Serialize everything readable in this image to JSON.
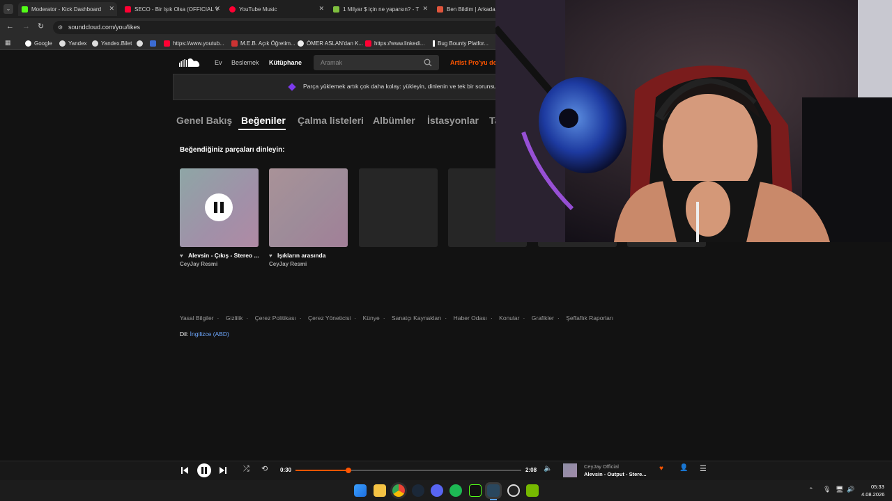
{
  "browser": {
    "tabs": [
      {
        "title": "Moderator - Kick Dashboard",
        "color": "#53fc18"
      },
      {
        "title": "SECO - Bir Işık Olsa (OFFICIAL V",
        "color": "#ff0033"
      },
      {
        "title": "YouTube Music",
        "color": "#ff0033"
      },
      {
        "title": "1 Milyar $ için ne yaparsın? - T",
        "color": "#7fbf3f"
      },
      {
        "title": "Ben Bildim | Arkadaşl",
        "color": "#e0553c"
      }
    ],
    "address": "soundcloud.com/you/likes",
    "bookmarks": [
      "Google",
      "Yandex",
      "Yandex.Bilet",
      "",
      "",
      "https://www.youtub...",
      "M.E.B. Açık Öğretim...",
      "ÖMER ASLAN'dan K...",
      "https://www.linkedi...",
      "Bug Bounty Platfor..."
    ]
  },
  "soundcloud": {
    "nav": {
      "home": "Ev",
      "feed": "Beslemek",
      "library": "Kütüphane",
      "search_placeholder": "Aramak",
      "artist_pro": "Artist Pro'yu den"
    },
    "banner": "Parça yüklemek artık çok daha kolay: yükleyin, dinlenin ve tek bir sorunsu",
    "tabs": [
      "Genel Bakış",
      "Beğeniler",
      "Çalma listeleri",
      "Albümler",
      "İstasyonlar",
      "Ta"
    ],
    "active_tab": "Beğeniler",
    "section_title": "Beğendiğiniz parçaları dinleyin:",
    "tracks": [
      {
        "title": "Alevsin - Çıkış - Stereo ...",
        "artist": "CeyJay Resmi"
      },
      {
        "title": "Işıkların arasında",
        "artist": "CeyJay Resmi"
      }
    ],
    "footer_links": [
      "Yasal Bilgiler",
      "Gizlilik",
      "Çerez Politikası",
      "Çerez Yöneticisi",
      "Künye",
      "Sanatçı Kaynakları",
      "Haber Odası",
      "Konular",
      "Grafikler",
      "Şeffaflık Raporları"
    ],
    "language_label": "Dil:",
    "language_value": "İngilizce (ABD)"
  },
  "player": {
    "elapsed": "0:30",
    "duration": "2:08",
    "progress": 0.234,
    "artist": "CeyJay Official",
    "title": "Alevsin - Output - Stere..."
  },
  "taskbar": {
    "time": "05:33",
    "date": "4.08.2026"
  },
  "colors": {
    "accent": "#ff5500",
    "link": "#6ea8fe"
  }
}
